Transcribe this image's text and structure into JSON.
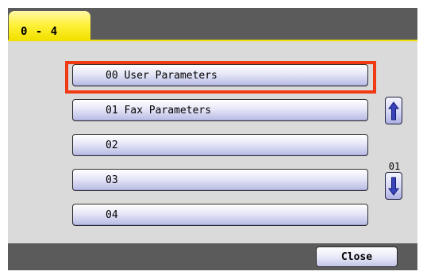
{
  "tab": {
    "label": "0 - 4"
  },
  "menu": {
    "items": [
      {
        "label": "00  User Parameters",
        "selected": true
      },
      {
        "label": "01  Fax Parameters",
        "selected": false
      },
      {
        "label": "02",
        "selected": false
      },
      {
        "label": "03",
        "selected": false
      },
      {
        "label": "04",
        "selected": false
      }
    ]
  },
  "pager": {
    "current": "01",
    "separator": "/",
    "total": "01",
    "up_icon": "arrow-up-icon",
    "down_icon": "arrow-down-icon"
  },
  "footer": {
    "close_label": "Close"
  },
  "colors": {
    "tab": "#fff13a",
    "selection": "#f03a13",
    "panel": "#dadada",
    "frame": "#5b5b5b",
    "button": "#d9dbf5"
  }
}
